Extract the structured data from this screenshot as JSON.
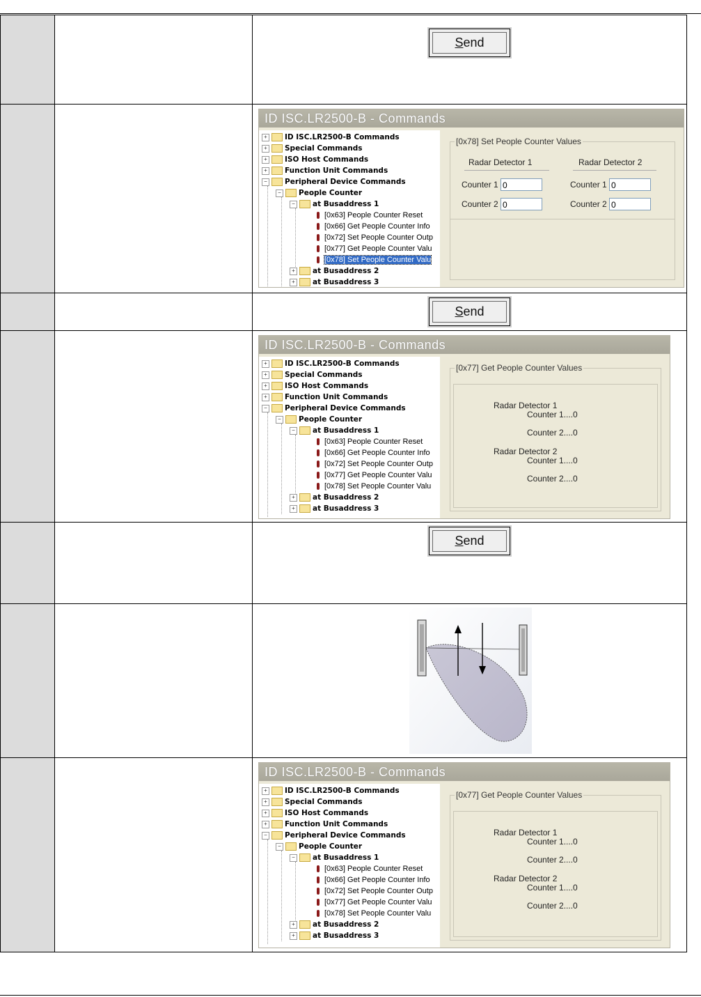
{
  "send_label": "Send",
  "send_accel": "S",
  "send_rest": "end",
  "panel_title": "ID ISC.LR2500-B - Commands",
  "tree": {
    "root_items": [
      "ID ISC.LR2500-B Commands",
      "Special Commands",
      "ISO Host Commands",
      "Function Unit Commands",
      "Peripheral Device Commands"
    ],
    "people_counter": "People Counter",
    "busaddress_1": "at Busaddress 1",
    "busaddress_2": "at Busaddress 2",
    "busaddress_3": "at Busaddress 3",
    "commands": [
      "[0x63] People Counter Reset",
      "[0x66] Get People Counter Info",
      "[0x72] Set People Counter Outp",
      "[0x77] Get People Counter Valu",
      "[0x78] Set People Counter Valu"
    ]
  },
  "set_panel": {
    "group_title": "[0x78] Set People Counter Values",
    "detector_1": "Radar Detector 1",
    "detector_2": "Radar Detector 2",
    "counter_1_label": "Counter 1",
    "counter_2_label": "Counter 2",
    "d1_counter_1": "0",
    "d1_counter_2": "0",
    "d2_counter_1": "0",
    "d2_counter_2": "0"
  },
  "get_panel_a": {
    "group_title": "[0x77] Get People Counter Values",
    "detector_1": "Radar Detector 1",
    "detector_2": "Radar Detector 2",
    "d1_c1": "Counter 1....0",
    "d1_c2": "Counter 2....0",
    "d2_c1": "Counter 1....0",
    "d2_c2": "Counter 2....0"
  },
  "get_panel_b": {
    "group_title": "[0x77] Get People Counter Values",
    "detector_1": "Radar Detector 1",
    "detector_2": "Radar Detector 2",
    "d1_c1": "Counter 1....0",
    "d1_c2": "Counter 2....0",
    "d2_c1": "Counter 1....0",
    "d2_c2": "Counter 2....0"
  }
}
